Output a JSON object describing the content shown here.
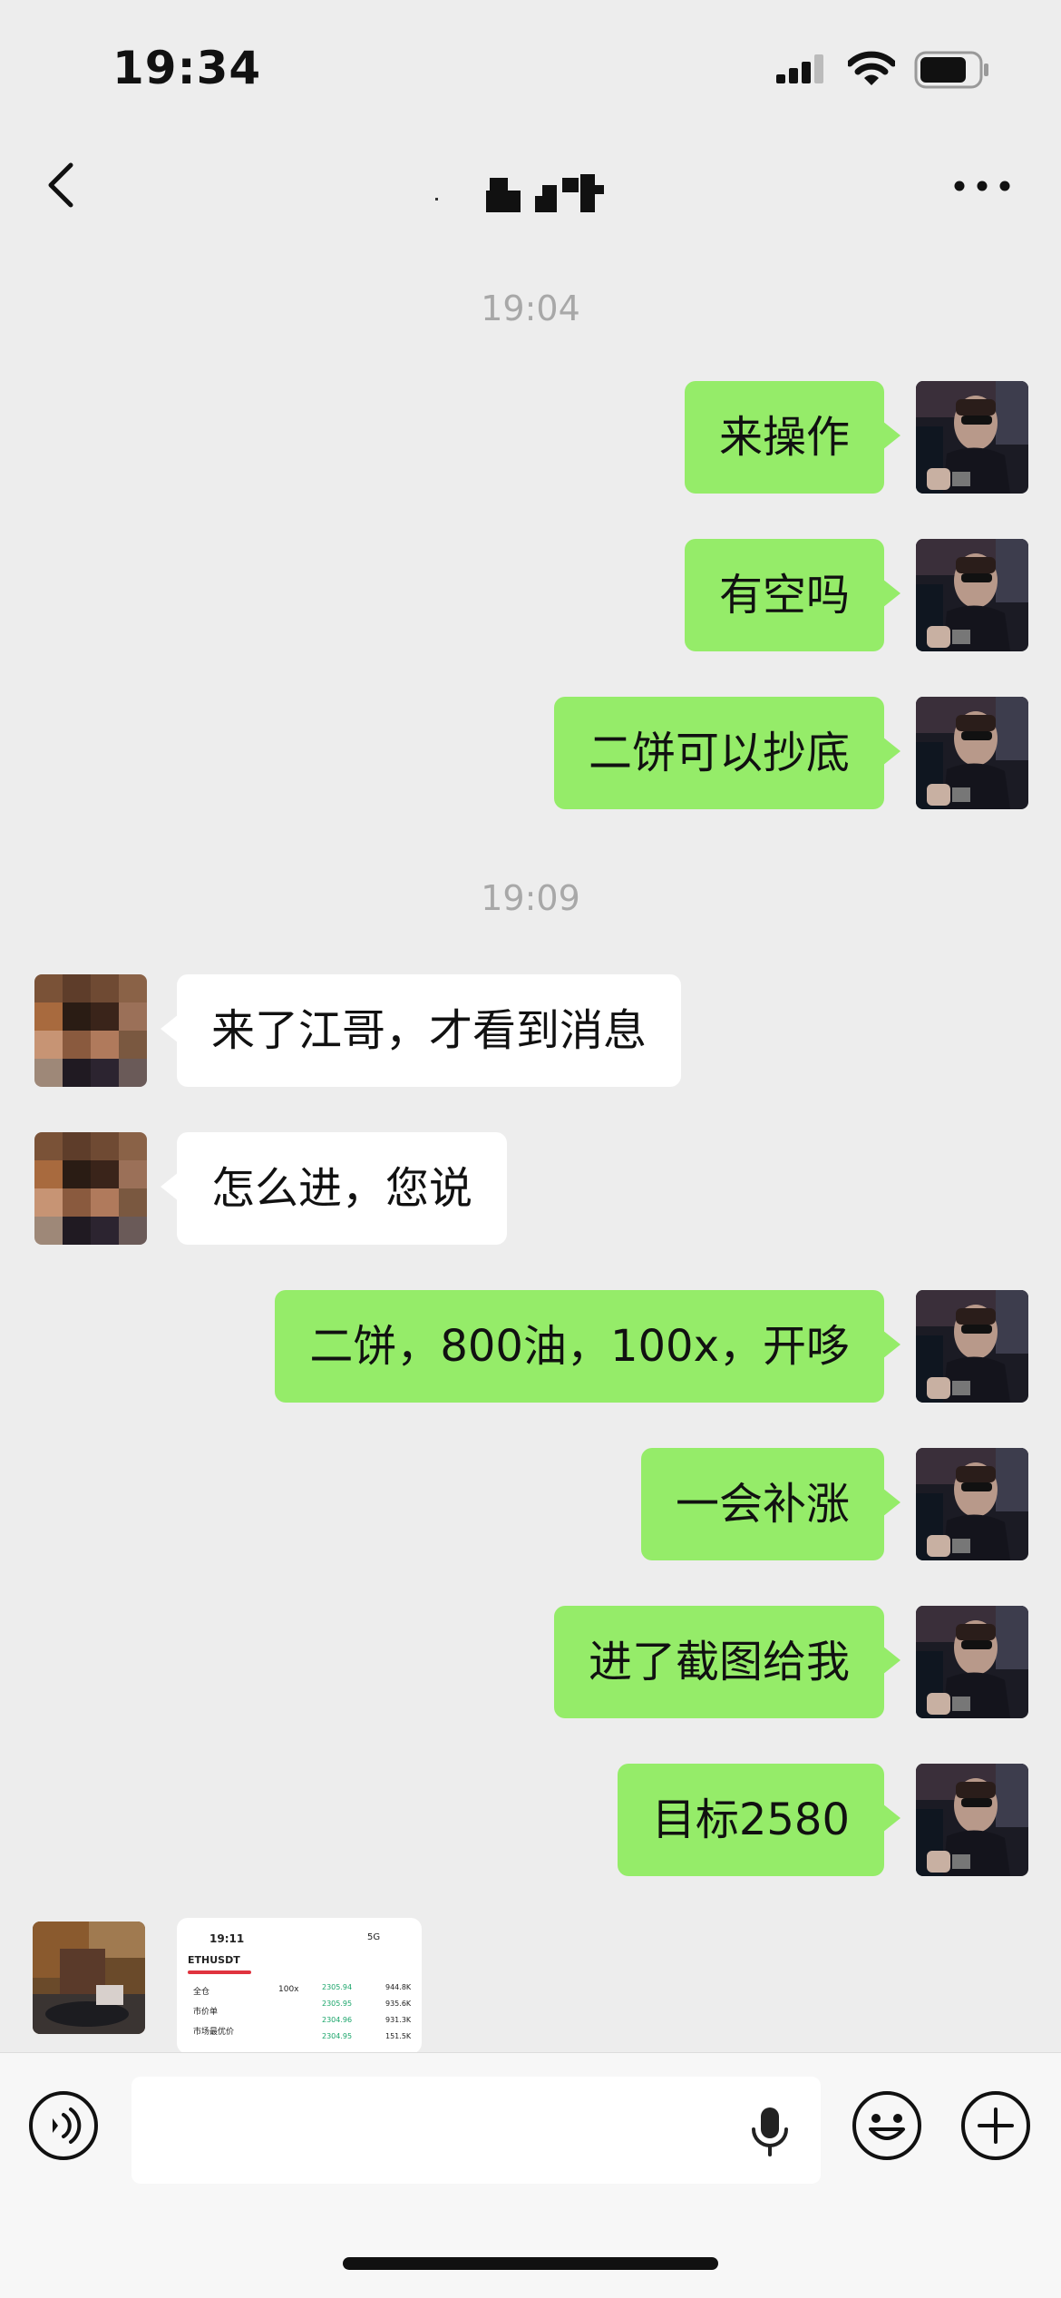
{
  "status_bar": {
    "time": "19:34"
  },
  "nav": {
    "title": ""
  },
  "timestamps": [
    "19:04",
    "19:09"
  ],
  "messages": [
    {
      "from": "me",
      "text": "来操作"
    },
    {
      "from": "me",
      "text": "有空吗"
    },
    {
      "from": "me",
      "text": "二饼可以抄底"
    },
    {
      "from": "them",
      "text": "来了江哥，才看到消息"
    },
    {
      "from": "them",
      "text": "怎么进，您说"
    },
    {
      "from": "me",
      "text": "二饼，800油，100x，开哆"
    },
    {
      "from": "me",
      "text": "一会补涨"
    },
    {
      "from": "me",
      "text": "进了截图给我"
    },
    {
      "from": "me",
      "text": "目标2580"
    }
  ],
  "image_message": {
    "time": "19:11",
    "network": "5G",
    "pair": "ETHUSDT",
    "leverage": "100x",
    "rows": [
      "全仓",
      "市价单",
      "市场最优价"
    ],
    "prices": [
      "2305.94",
      "2305.95",
      "2304.96",
      "2304.95"
    ],
    "amounts": [
      "944.8K",
      "935.6K",
      "931.3K",
      "151.5K"
    ]
  },
  "icons": [
    "back-icon",
    "more-icon",
    "voice-toggle-icon",
    "microphone-icon",
    "emoji-icon",
    "plus-icon"
  ]
}
